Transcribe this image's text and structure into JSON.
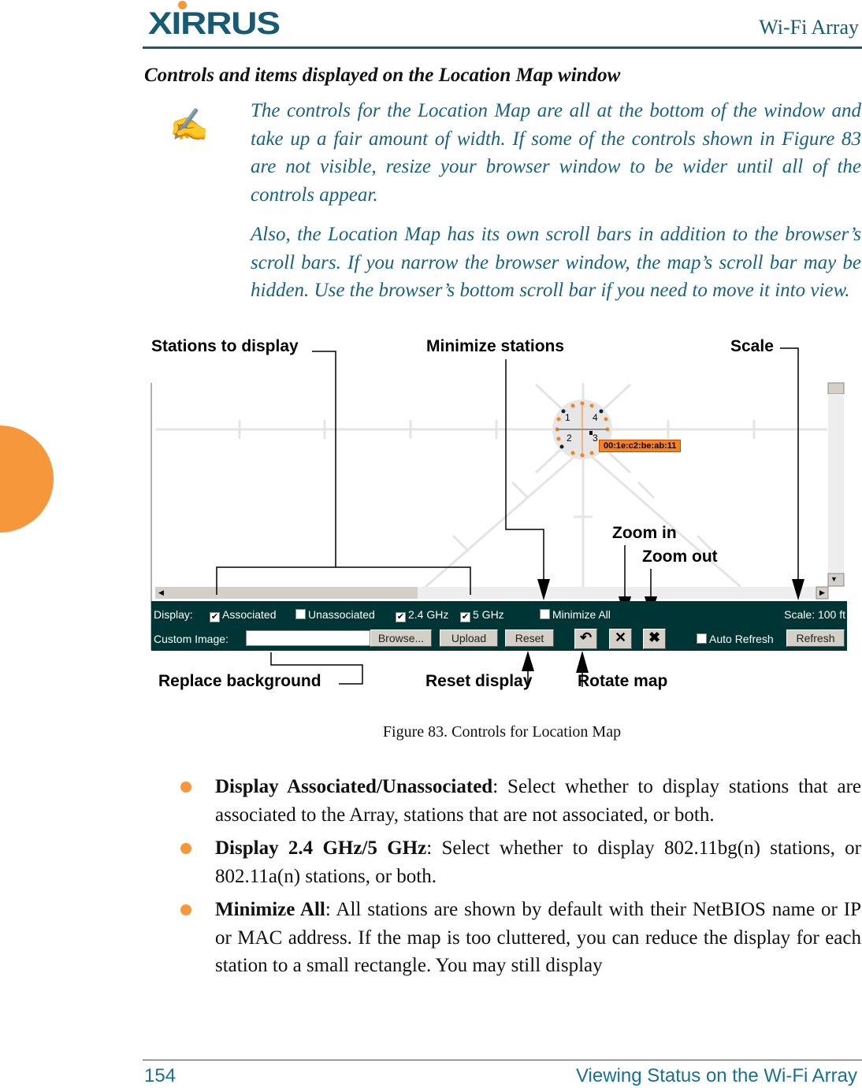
{
  "header": {
    "logo": "XIRRUS",
    "product": "Wi-Fi Array"
  },
  "section_title": "Controls and items displayed on the Location Map window",
  "note": {
    "icon": "pen-note-icon",
    "paragraphs": [
      "The controls for the Location Map are all at the bottom of the window and take up a fair amount of width. If some of the controls shown in Figure 83 are not visible, resize your browser window to be wider until all of the controls appear.",
      "Also, the Location Map has its own scroll bars in addition to the browser’s scroll bars. If you narrow the browser window, the map’s scroll bar may be hidden. Use the browser’s bottom scroll bar if you need to move it into view."
    ]
  },
  "figure": {
    "callouts": {
      "stations": "Stations to display",
      "minimize": "Minimize stations",
      "scale": "Scale",
      "zoom_in": "Zoom in",
      "zoom_out": "Zoom out",
      "replace_bg": "Replace background",
      "reset": "Reset display",
      "rotate": "Rotate map"
    },
    "map": {
      "sectors": [
        "1",
        "4",
        "2",
        "3"
      ],
      "mac_label": "00:1e:c2:be:ab:11"
    },
    "controls": {
      "display_label": "Display:",
      "associated": {
        "label": "Associated",
        "checked": true
      },
      "unassociated": {
        "label": "Unassociated",
        "checked": false
      },
      "ghz24": {
        "label": "2.4 GHz",
        "checked": true
      },
      "ghz5": {
        "label": "5 GHz",
        "checked": true
      },
      "minimize_all": {
        "label": "Minimize All",
        "checked": false
      },
      "scale": "Scale: 100 ft",
      "custom_image_label": "Custom Image:",
      "custom_image_value": "",
      "browse": "Browse...",
      "upload": "Upload",
      "reset": "Reset",
      "auto_refresh": {
        "label": "Auto Refresh",
        "checked": false
      },
      "refresh": "Refresh"
    },
    "caption": "Figure 83. Controls for Location Map"
  },
  "bullets": [
    {
      "term": "Display Associated/Unassociated",
      "text": ": Select whether to display stations that are associated to the Array, stations that are not associated, or both."
    },
    {
      "term": "Display 2.4 GHz/5 GHz",
      "text": ": Select whether to display 802.11bg(n) stations, or 802.11a(n) stations, or both."
    },
    {
      "term": "Minimize All",
      "text": ": All stations are shown by default with their NetBIOS name or IP or MAC address. If the map is too cluttered, you can reduce the display for each station to a small rectangle. You may still display"
    }
  ],
  "footer": {
    "page": "154",
    "chapter": "Viewing Status on the Wi-Fi Array"
  },
  "colors": {
    "brand": "#175a73",
    "accent": "#f7973b",
    "control_bar": "#003535"
  }
}
